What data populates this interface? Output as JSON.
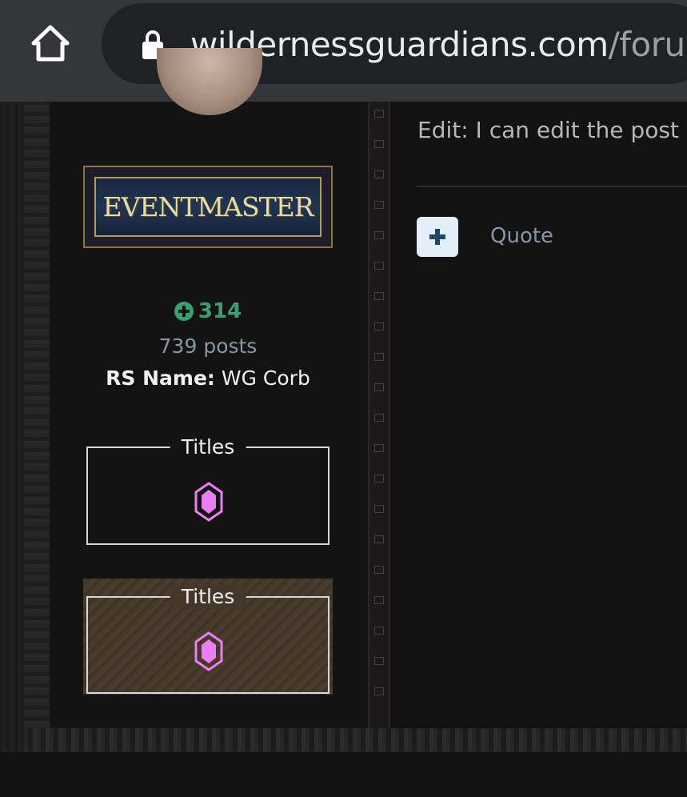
{
  "browser": {
    "url_domain": "wildernessguardians.com",
    "url_path": "/foru",
    "home_icon": "home-icon",
    "lock_icon": "lock-icon"
  },
  "author": {
    "group_badge": "EVENTMASTER",
    "reputation": "314",
    "posts": "739 posts",
    "rs_label": "RS Name:",
    "rs_value": "WG Corb",
    "titles_label_1": "Titles",
    "titles_label_2": "Titles",
    "title_icon": "gem-icon"
  },
  "post": {
    "edit_text": "Edit: I can edit the post a",
    "quote_label": "Quote",
    "multiquote_icon": "plus-icon"
  },
  "colors": {
    "accent_green": "#3a9f73",
    "gem_pink": "#ea7ef2",
    "badge_gold": "#e7d9a6"
  }
}
